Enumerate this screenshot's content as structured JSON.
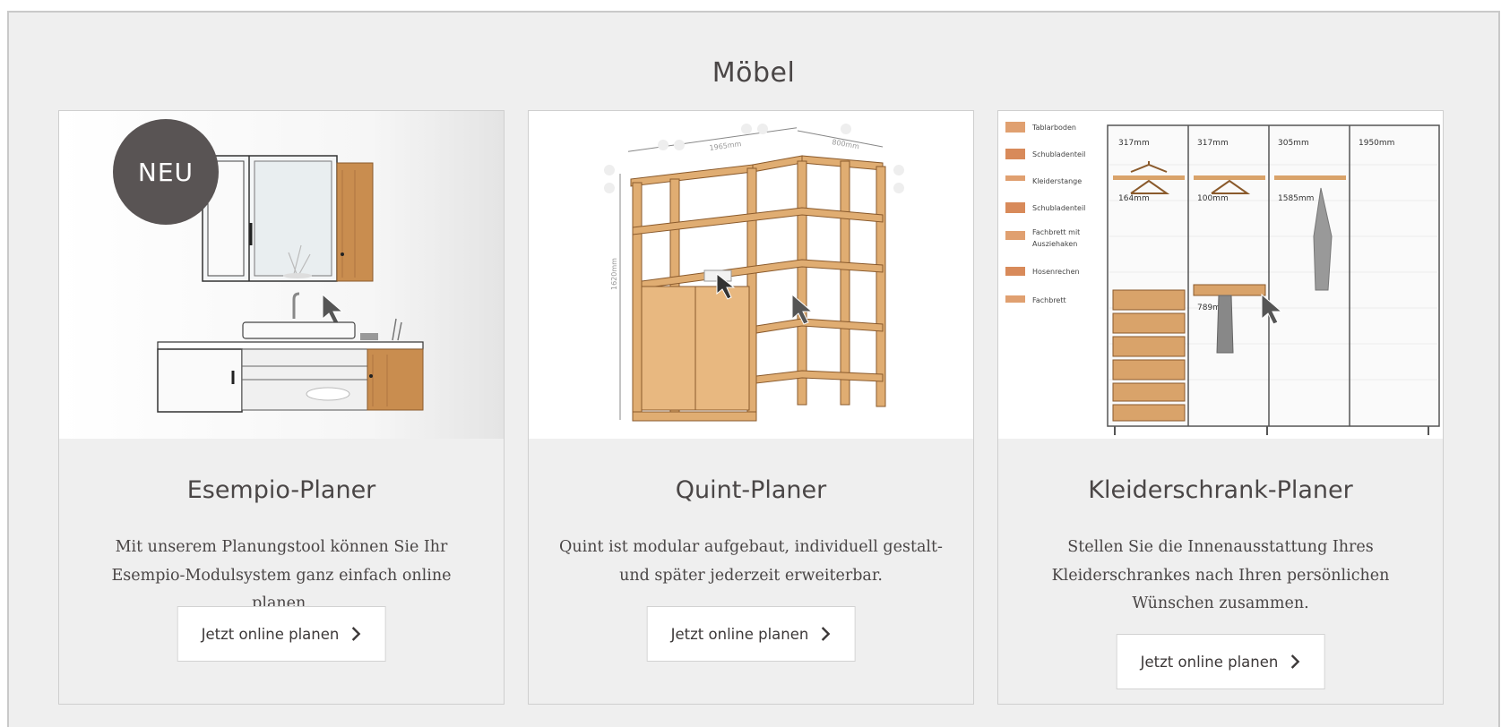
{
  "section": {
    "title": "Möbel"
  },
  "cards": [
    {
      "badge": "NEU",
      "title": "Esempio-Planer",
      "description": "Mit unserem Planungstool können Sie Ihr Esempio-Modulsystem ganz einfach online planen.",
      "cta": "Jetzt online planen"
    },
    {
      "title": "Quint-Planer",
      "description": "Quint ist modular aufgebaut, individuell gestalt- und später jederzeit erweiterbar.",
      "cta": "Jetzt online planen",
      "image_labels": {
        "width": "1965mm",
        "depth": "800mm",
        "height": "1620mm"
      }
    },
    {
      "title": "Kleiderschrank-Planer",
      "description": "Stellen Sie die Innenausstattung Ihres Kleiderschrankes nach Ihren persönlichen Wünschen zusammen.",
      "cta": "Jetzt online planen",
      "legend": [
        "Tablarboden",
        "Schubladenteil",
        "Kleiderstange",
        "Schubladenteil",
        "Fachbrett mit",
        "Ausziehaken",
        "Hosenrechen",
        "Fachbrett"
      ],
      "measures": [
        "317mm",
        "317mm",
        "305mm",
        "1950mm",
        "164mm",
        "100mm",
        "1585mm",
        "789mm"
      ]
    }
  ],
  "colors": {
    "background": "#efefef",
    "wood": "#d9a36a",
    "badge": "#595454",
    "text": "#4a4646"
  }
}
